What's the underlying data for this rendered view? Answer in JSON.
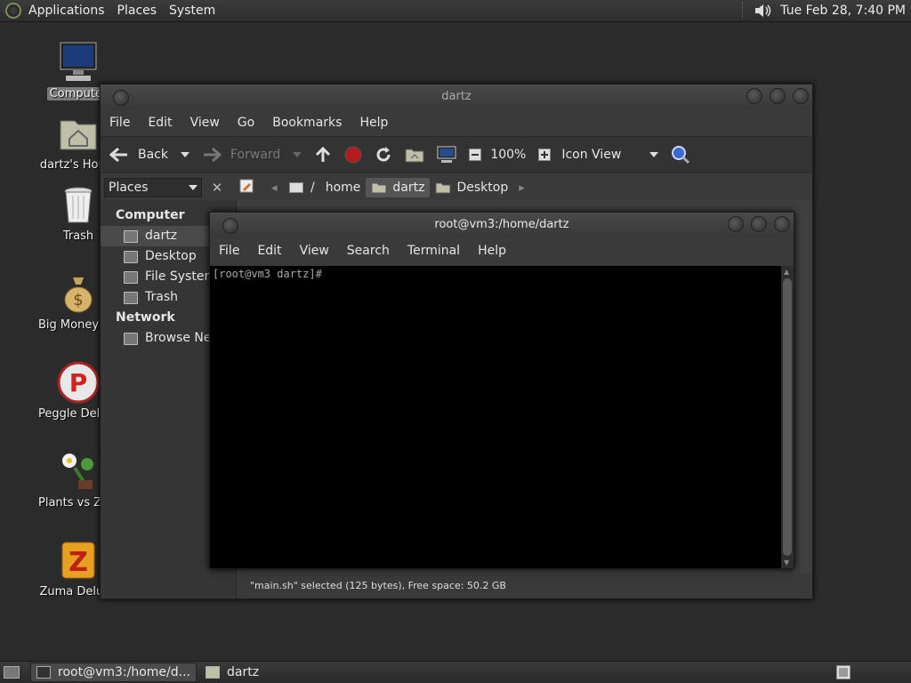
{
  "top_panel": {
    "menus": [
      "Applications",
      "Places",
      "System"
    ],
    "clock": "Tue Feb 28,  7:40 PM"
  },
  "desktop_icons": [
    {
      "label": "Computer",
      "icon": "computer-icon",
      "selected": true
    },
    {
      "label": "dartz's Home",
      "icon": "home-folder-icon"
    },
    {
      "label": "Trash",
      "icon": "trash-icon"
    },
    {
      "label": "Big Money Deluxe",
      "icon": "money-bag-icon"
    },
    {
      "label": "Peggle Deluxe",
      "icon": "peggle-icon"
    },
    {
      "label": "Plants vs Zombies",
      "icon": "plants-icon"
    },
    {
      "label": "Zuma Deluxe",
      "icon": "zuma-icon"
    }
  ],
  "nautilus": {
    "title": "dartz",
    "menus": [
      "File",
      "Edit",
      "View",
      "Go",
      "Bookmarks",
      "Help"
    ],
    "toolbar": {
      "back": "Back",
      "forward": "Forward",
      "zoom": "100%",
      "view_mode": "Icon View"
    },
    "places_combo": "Places",
    "breadcrumbs": [
      "/",
      "home",
      "dartz",
      "Desktop"
    ],
    "sidebar": {
      "computer_head": "Computer",
      "computer_items": [
        "dartz",
        "Desktop",
        "File System",
        "Trash"
      ],
      "network_head": "Network",
      "network_items": [
        "Browse Network"
      ]
    },
    "status": "\"main.sh\" selected (125 bytes), Free space: 50.2 GB"
  },
  "terminal": {
    "title": "root@vm3:/home/dartz",
    "menus": [
      "File",
      "Edit",
      "View",
      "Search",
      "Terminal",
      "Help"
    ],
    "prompt": "[root@vm3 dartz]#"
  },
  "taskbar": {
    "tasks": [
      "root@vm3:/home/d...",
      "dartz"
    ]
  }
}
